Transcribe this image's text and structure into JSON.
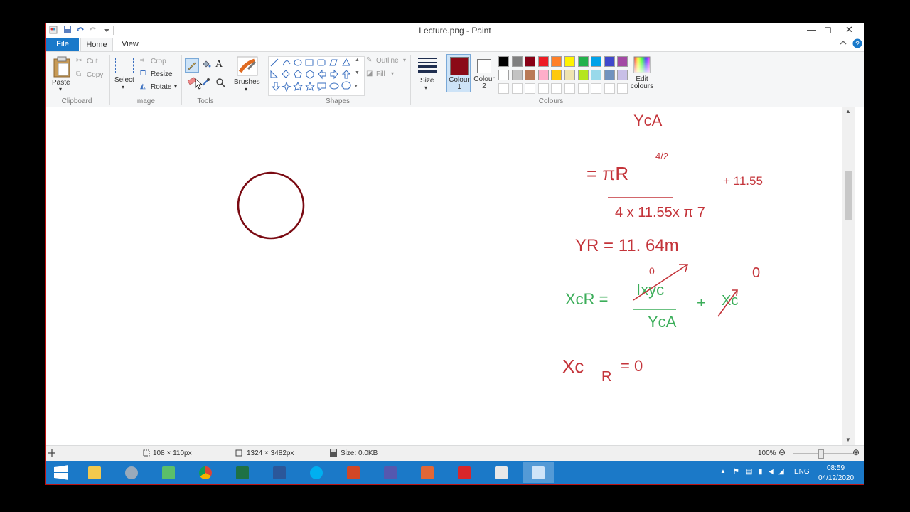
{
  "window": {
    "title": "Lecture.png - Paint"
  },
  "window_controls": {
    "minimize": "—",
    "maximize": "◻",
    "close": "✕"
  },
  "tabs": {
    "file": "File",
    "home": "Home",
    "view": "View"
  },
  "clipboard": {
    "paste": "Paste",
    "cut": "Cut",
    "copy": "Copy",
    "group": "Clipboard"
  },
  "image": {
    "select": "Select",
    "crop": "Crop",
    "resize": "Resize",
    "rotate": "Rotate",
    "group": "Image"
  },
  "tools": {
    "group": "Tools",
    "text_icon": "A"
  },
  "brushes": {
    "label": "Brushes"
  },
  "shapes": {
    "outline": "Outline",
    "fill": "Fill",
    "group": "Shapes"
  },
  "size": {
    "label": "Size"
  },
  "colours": {
    "colour1": "Colour 1",
    "colour2": "Colour 2",
    "edit": "Edit colours",
    "group": "Colours",
    "active_color": "#8b0a17",
    "row1": [
      "#000000",
      "#7f7f7f",
      "#880015",
      "#ed1c24",
      "#ff7f27",
      "#fff200",
      "#22b14c",
      "#00a2e8",
      "#3f48cc",
      "#a349a4"
    ],
    "row2": [
      "#ffffff",
      "#c3c3c3",
      "#b97a57",
      "#ffaec9",
      "#ffc90e",
      "#efe4b0",
      "#b5e61d",
      "#99d9ea",
      "#7092be",
      "#c8bfe7"
    ]
  },
  "canvas_notes": {
    "line1": "YcA",
    "line2": "= πR",
    "line2_sup": "4/2",
    "line2_side": "+ 11.55",
    "line3": "4 x 11.55x π 7",
    "line4": "YR = 11. 64m",
    "line5_lhs": "XcR =",
    "line5_num": "Ixyc",
    "line5_plus": "+",
    "line5_xc": "Xc",
    "line5_zero_a": "0",
    "line5_zero_b": "0",
    "line5_den": "YcA",
    "line6_lhs": "Xc",
    "line6_sub": "R",
    "line6_rhs": "= 0"
  },
  "status": {
    "selection": "108 × 110px",
    "image_size": "1324 × 3482px",
    "file_size": "Size: 0.0KB",
    "zoom": "100%"
  },
  "tray": {
    "lang": "ENG",
    "time": "08:59",
    "date": "04/12/2020"
  }
}
